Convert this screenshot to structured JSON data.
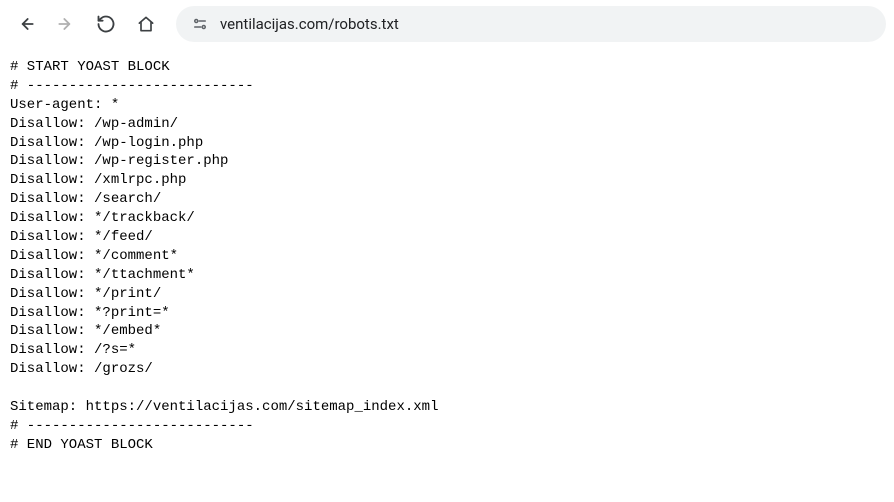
{
  "toolbar": {
    "url": "ventilacijas.com/robots.txt"
  },
  "content": {
    "lines": [
      "# START YOAST BLOCK",
      "# ---------------------------",
      "User-agent: *",
      "Disallow: /wp-admin/",
      "Disallow: /wp-login.php",
      "Disallow: /wp-register.php",
      "Disallow: /xmlrpc.php",
      "Disallow: /search/",
      "Disallow: */trackback/",
      "Disallow: */feed/",
      "Disallow: */comment*",
      "Disallow: */ttachment*",
      "Disallow: */print/",
      "Disallow: *?print=*",
      "Disallow: */embed*",
      "Disallow: /?s=*",
      "Disallow: /grozs/",
      "",
      "Sitemap: https://ventilacijas.com/sitemap_index.xml",
      "# ---------------------------",
      "# END YOAST BLOCK"
    ]
  }
}
